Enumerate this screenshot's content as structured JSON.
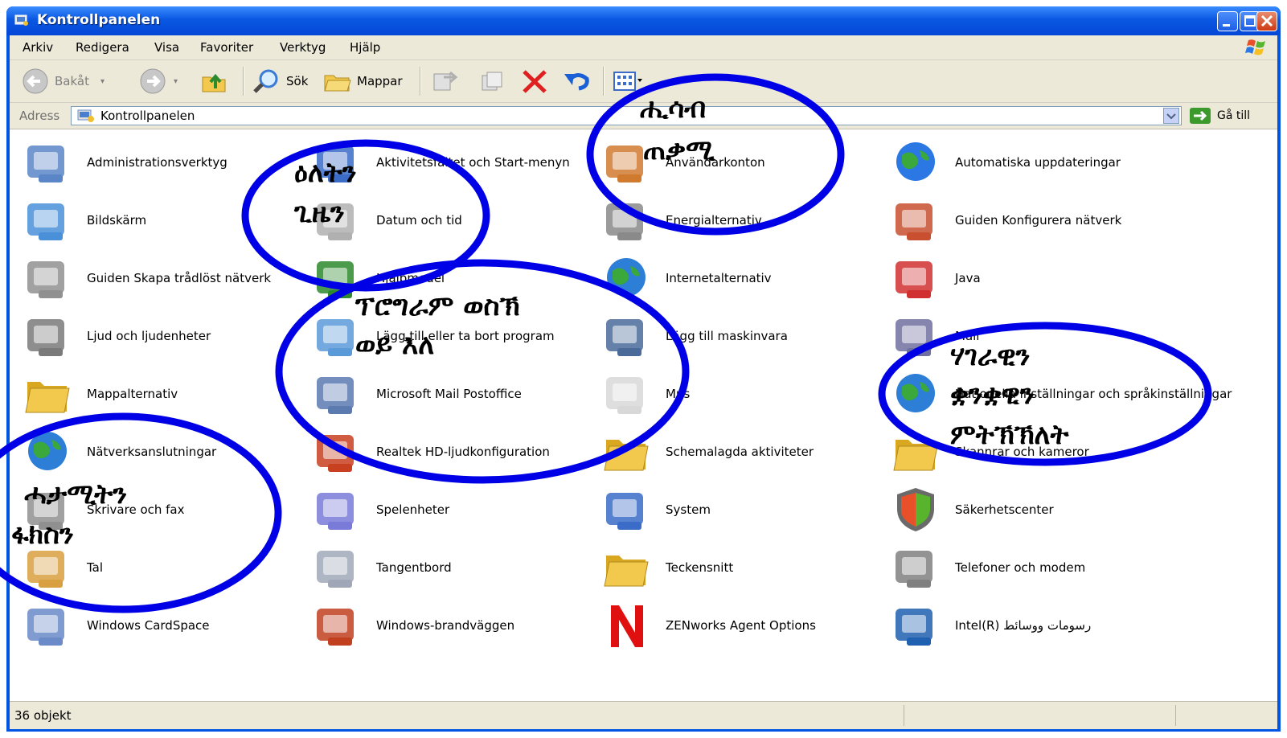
{
  "window": {
    "title": "Kontrollpanelen"
  },
  "menubar": {
    "items": [
      "Arkiv",
      "Redigera",
      "Visa",
      "Favoriter",
      "Verktyg",
      "Hjälp"
    ]
  },
  "toolbar": {
    "back_label": "Bakåt",
    "search_label": "Sök",
    "folders_label": "Mappar"
  },
  "address": {
    "label": "Adress",
    "value": "Kontrollpanelen",
    "go_label": "Gå till"
  },
  "items": [
    {
      "label": "Administrationsverktyg",
      "icon": "admin-tools-icon"
    },
    {
      "label": "Aktivitetsfältet och Start-menyn",
      "icon": "taskbar-icon"
    },
    {
      "label": "Användarkonton",
      "icon": "user-accounts-icon"
    },
    {
      "label": "Automatiska uppdateringar",
      "icon": "windows-update-icon"
    },
    {
      "label": "Bildskärm",
      "icon": "display-icon"
    },
    {
      "label": "Datum och tid",
      "icon": "clock-icon"
    },
    {
      "label": "Energialternativ",
      "icon": "power-options-icon"
    },
    {
      "label": "Guiden Konfigurera nätverk",
      "icon": "network-setup-icon"
    },
    {
      "label": "Guiden Skapa trådlöst nätverk",
      "icon": "wireless-icon"
    },
    {
      "label": "Hjälpmedel",
      "icon": "accessibility-icon"
    },
    {
      "label": "Internetalternativ",
      "icon": "internet-options-icon"
    },
    {
      "label": "Java",
      "icon": "java-icon"
    },
    {
      "label": "Ljud och ljudenheter",
      "icon": "speaker-icon"
    },
    {
      "label": "Lägg till eller ta bort program",
      "icon": "add-remove-programs-icon"
    },
    {
      "label": "Lägg till maskinvara",
      "icon": "add-hardware-icon"
    },
    {
      "label": "Mail",
      "icon": "mail-icon"
    },
    {
      "label": "Mappalternativ",
      "icon": "folder-options-icon"
    },
    {
      "label": "Microsoft Mail Postoffice",
      "icon": "postoffice-icon"
    },
    {
      "label": "Mus",
      "icon": "mouse-icon"
    },
    {
      "label": "Nationella inställningar och språkinställningar",
      "icon": "regional-globe-icon"
    },
    {
      "label": "Nätverksanslutningar",
      "icon": "network-connections-icon"
    },
    {
      "label": "Realtek HD-ljudkonfiguration",
      "icon": "realtek-audio-icon"
    },
    {
      "label": "Schemalagda aktiviteter",
      "icon": "scheduled-tasks-icon"
    },
    {
      "label": "Skannrar och kameror",
      "icon": "scanner-camera-icon"
    },
    {
      "label": "Skrivare och fax",
      "icon": "printer-icon"
    },
    {
      "label": "Spelenheter",
      "icon": "gamepad-icon"
    },
    {
      "label": "System",
      "icon": "system-icon"
    },
    {
      "label": "Säkerhetscenter",
      "icon": "security-shield-icon"
    },
    {
      "label": "Tal",
      "icon": "speech-icon"
    },
    {
      "label": "Tangentbord",
      "icon": "keyboard-icon"
    },
    {
      "label": "Teckensnitt",
      "icon": "fonts-folder-icon"
    },
    {
      "label": "Telefoner och modem",
      "icon": "phone-modem-icon"
    },
    {
      "label": "Windows CardSpace",
      "icon": "cardspace-icon"
    },
    {
      "label": "Windows-brandväggen",
      "icon": "firewall-icon"
    },
    {
      "label": "ZENworks Agent Options",
      "icon": "zenworks-icon"
    },
    {
      "label": "Intel(R) رسومات ووسائط",
      "icon": "intel-graphics-icon"
    }
  ],
  "statusbar": {
    "text": "36 objekt"
  },
  "annotations": {
    "date_time": [
      "ዕለትን",
      "ጊዜን"
    ],
    "user_accounts": [
      "ሒሳብ",
      "ጠቃሚ"
    ],
    "add_remove": [
      "ፕሮግራም ወስኽ",
      "ወይ እለ"
    ],
    "regional": [
      "ሃገራዊን",
      "ቋንቋዊን",
      "ምትኽኽለት"
    ],
    "printers": [
      "ሓታሚትን",
      "ፋክስን"
    ]
  },
  "colors": {
    "titlebar": "#0a58e2",
    "window_frame": "#0054e3",
    "annotation_circle": "#0000e6",
    "chrome": "#ece9d8"
  }
}
